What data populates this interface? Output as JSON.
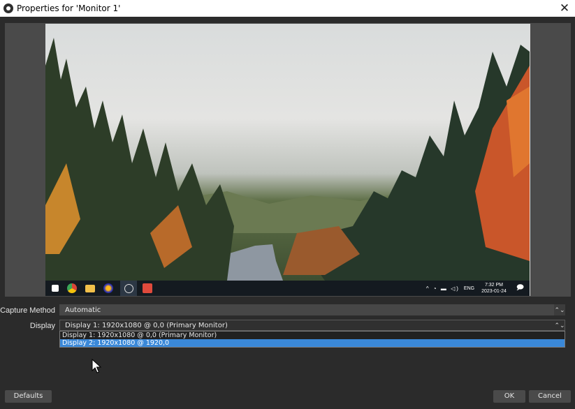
{
  "window": {
    "title": "Properties for 'Monitor 1'",
    "close_glyph": "✕"
  },
  "preview": {
    "taskbar": {
      "icons": [
        "windows-start-icon",
        "chrome-icon",
        "file-explorer-icon",
        "firefox-icon",
        "obs-icon",
        "app-icon"
      ],
      "tray_symbols": "^ ◔ ▬ ◁)",
      "language": "ENG",
      "time": "7:32 PM",
      "date": "2023-01-24",
      "notification_glyph": "🗩"
    }
  },
  "form": {
    "capture_method": {
      "label": "Capture Method",
      "value": "Automatic"
    },
    "display": {
      "label": "Display",
      "value": "Display 1: 1920x1080 @ 0,0 (Primary Monitor)",
      "options": [
        "Display 1: 1920x1080 @ 0,0 (Primary Monitor)",
        "Display 2: 1920x1080 @ 1920,0"
      ],
      "highlighted_index": 1
    }
  },
  "buttons": {
    "defaults": "Defaults",
    "ok": "OK",
    "cancel": "Cancel"
  },
  "colors": {
    "background": "#2b2b2b",
    "selection": "#3a88d8",
    "button": "#4a4a4a"
  }
}
